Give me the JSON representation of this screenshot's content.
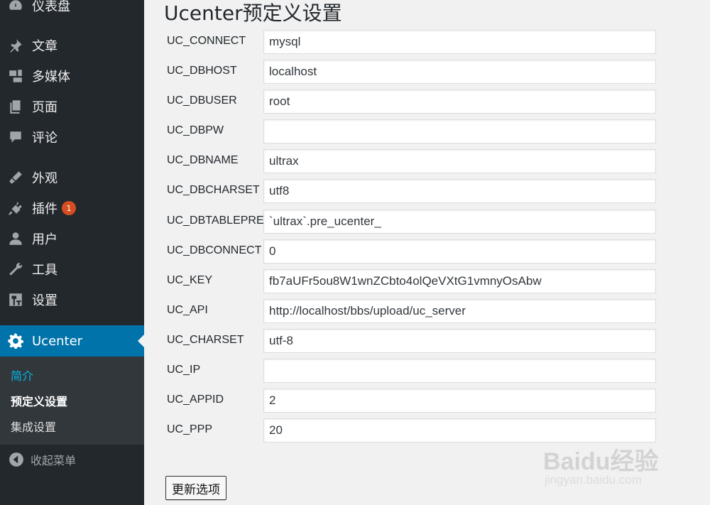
{
  "sidebar": {
    "items": [
      {
        "label": "仪表盘",
        "icon": "dashboard-icon"
      },
      {
        "label": "文章",
        "icon": "pin-icon"
      },
      {
        "label": "多媒体",
        "icon": "media-icon"
      },
      {
        "label": "页面",
        "icon": "pages-icon"
      },
      {
        "label": "评论",
        "icon": "comment-icon"
      },
      {
        "label": "外观",
        "icon": "appearance-icon"
      },
      {
        "label": "插件",
        "icon": "plugin-icon",
        "badge": "1"
      },
      {
        "label": "用户",
        "icon": "user-icon"
      },
      {
        "label": "工具",
        "icon": "wrench-icon"
      },
      {
        "label": "设置",
        "icon": "settings-icon"
      }
    ],
    "active": {
      "label": "Ucenter",
      "icon": "gear-icon"
    },
    "submenu": [
      {
        "label": "简介",
        "color": "#00b9eb"
      },
      {
        "label": "预定义设置",
        "color": "#ffffff"
      },
      {
        "label": "集成设置",
        "color": "#dddddd"
      }
    ],
    "collapse_label": "收起菜单",
    "accent": "#0073aa"
  },
  "main": {
    "title": "Ucenter预定义设置",
    "fields": [
      {
        "label": "UC_CONNECT",
        "value": "mysql"
      },
      {
        "label": "UC_DBHOST",
        "value": "localhost"
      },
      {
        "label": "UC_DBUSER",
        "value": "root"
      },
      {
        "label": "UC_DBPW",
        "value": ""
      },
      {
        "label": "UC_DBNAME",
        "value": "ultrax"
      },
      {
        "label": "UC_DBCHARSET",
        "value": "utf8"
      },
      {
        "label": "UC_DBTABLEPRE",
        "value": "`ultrax`.pre_ucenter_"
      },
      {
        "label": "UC_DBCONNECT",
        "value": "0"
      },
      {
        "label": "UC_KEY",
        "value": "fb7aUFr5ou8W1wnZCbto4olQeVXtG1vmnyOsAbw"
      },
      {
        "label": "UC_API",
        "value": "http://localhost/bbs/upload/uc_server"
      },
      {
        "label": "UC_CHARSET",
        "value": "utf-8"
      },
      {
        "label": "UC_IP",
        "value": ""
      },
      {
        "label": "UC_APPID",
        "value": "2"
      },
      {
        "label": "UC_PPP",
        "value": "20"
      }
    ],
    "submit_label": "更新选项"
  },
  "watermark": {
    "logo": "Baidu经验",
    "site": "jingyan.baidu.com"
  }
}
